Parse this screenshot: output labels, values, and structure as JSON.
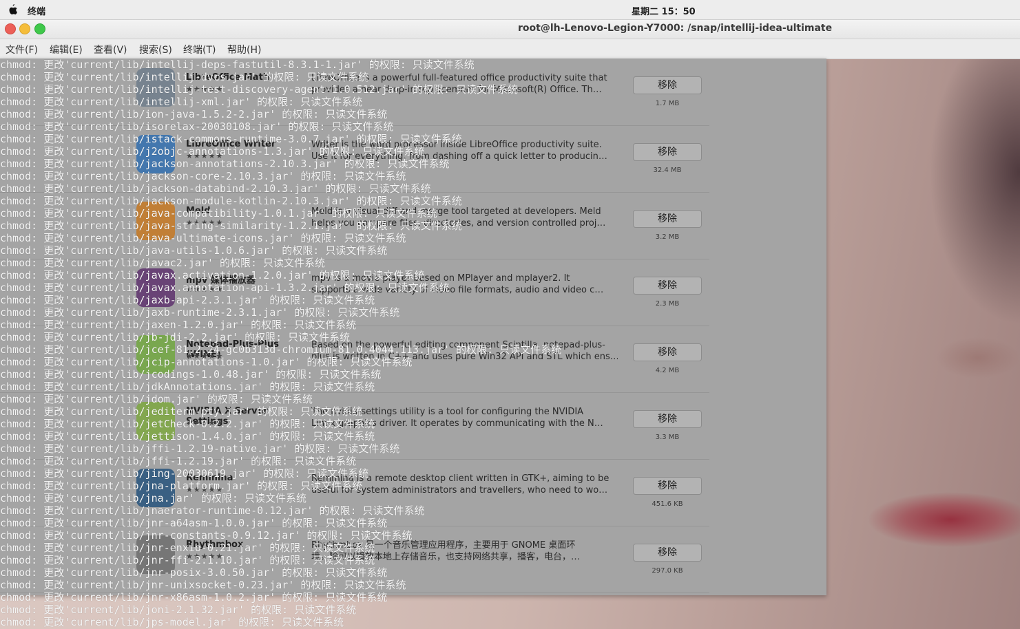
{
  "topbar": {
    "app_name": "终端",
    "clock": "星期二 15：50"
  },
  "window": {
    "title": "root@lh-Lenovo-Legion-Y7000: /snap/intellij-idea-ultimate"
  },
  "menu": [
    "文件(F)",
    "编辑(E)",
    "查看(V)",
    "搜索(S)",
    "终端(T)",
    "帮助(H)"
  ],
  "software": [
    {
      "name": "LibreOffice Math",
      "stars": "★★★★★",
      "desc1": "LibreOffice is a powerful full-featured office productivity suite that",
      "desc2": "provides a near drop-in replacement for Microsoft(R) Office.  Th…",
      "button": "移除",
      "size": "1.7 MB",
      "icon_color": "#6b7b8a"
    },
    {
      "name": "LibreOffice Writer",
      "stars": "★★★★★",
      "desc1": "Writer is the word processor inside LibreOffice productivity suite.",
      "desc2": "Use it for everything, from dashing off a quick letter to producin…",
      "button": "移除",
      "size": "32.4 MB",
      "icon_color": "#2a6cb0"
    },
    {
      "name": "Meld",
      "stars": "★★★★★",
      "desc1": "Meld is a visual diff and merge tool targeted at developers. Meld",
      "desc2": "helps you compare files, directories, and version controlled proj…",
      "button": "移除",
      "size": "3.2 MB",
      "icon_color": "#c8761a"
    },
    {
      "name": "mpv 媒体播放器",
      "stars": "★★★★★",
      "desc1": "mpv is a movie player based on MPlayer and mplayer2. It",
      "desc2": "supports a wide variety of video file formats, audio and video c…",
      "button": "移除",
      "size": "2.3 MB",
      "icon_color": "#5a2a6a"
    },
    {
      "name": "Notepad-Plus-Plus (WINE)",
      "stars": "★★★★★",
      "desc1": "Based on the powerful editing component Scintilla, notepad-plus-",
      "desc2": "plus is written in C++ and uses pure Win32 API and STL which ens…",
      "button": "移除",
      "size": "4.2 MB",
      "icon_color": "#6ea83a"
    },
    {
      "name": "NVIDIA X Server Settings",
      "stars": "★★★★★",
      "desc1": "The nvidia-settings utility is a tool for configuring the NVIDIA",
      "desc2": "Linux graphics driver.  It operates by communicating with the N…",
      "button": "移除",
      "size": "3.3 MB",
      "icon_color": "#7aa83a"
    },
    {
      "name": "Remmina",
      "stars": "★★★★★",
      "desc1": "Remmina is a remote desktop client written in GTK+, aiming to be",
      "desc2": "useful for system administrators and travellers, who need to wo…",
      "button": "移除",
      "size": "451.6 KB",
      "icon_color": "#1f4f7a"
    },
    {
      "name": "Rhythmbox",
      "stars": "★★★★★",
      "desc1": "Rhythmbox 是一个音乐管理应用程序，主要用于 GNOME 桌面环",
      "desc2": "境。除可以播放本地上存储音乐，也支持网络共享，播客，电台，…",
      "button": "移除",
      "size": "297.0 KB",
      "icon_color": "#6a6a6a"
    }
  ],
  "terminal_lines": [
    "chmod: 更改'current/lib/intellij-deps-fastutil-8.3.1-1.jar' 的权限: 只读文件系统",
    "chmod: 更改'current/lib/intellij-dvcs.jar' 的权限: 只读文件系统",
    "chmod: 更改'current/lib/intellij-test-discovery-agent-1.0.512.jar' 的权限: 只读文件系统",
    "chmod: 更改'current/lib/intellij-xml.jar' 的权限: 只读文件系统",
    "chmod: 更改'current/lib/ion-java-1.5.2-2.jar' 的权限: 只读文件系统",
    "chmod: 更改'current/lib/isorelax-20030108.jar' 的权限: 只读文件系统",
    "chmod: 更改'current/lib/istack-commons-runtime-3.0.7.jar' 的权限: 只读文件系统",
    "chmod: 更改'current/lib/j2objc-annotations-1.3.jar' 的权限: 只读文件系统",
    "chmod: 更改'current/lib/jackson-annotations-2.10.3.jar' 的权限: 只读文件系统",
    "chmod: 更改'current/lib/jackson-core-2.10.3.jar' 的权限: 只读文件系统",
    "chmod: 更改'current/lib/jackson-databind-2.10.3.jar' 的权限: 只读文件系统",
    "chmod: 更改'current/lib/jackson-module-kotlin-2.10.3.jar' 的权限: 只读文件系统",
    "chmod: 更改'current/lib/java-compatibility-1.0.1.jar' 的权限: 只读文件系统",
    "chmod: 更改'current/lib/java-string-similarity-1.2.1.jar' 的权限: 只读文件系统",
    "chmod: 更改'current/lib/java-ultimate-icons.jar' 的权限: 只读文件系统",
    "chmod: 更改'current/lib/java-utils-1.0.6.jar' 的权限: 只读文件系统",
    "chmod: 更改'current/lib/javac2.jar' 的权限: 只读文件系统",
    "chmod: 更改'current/lib/javax.activation-1.2.0.jar' 的权限: 只读文件系统",
    "chmod: 更改'current/lib/javax.annotation-api-1.3.2.jar' 的权限: 只读文件系统",
    "chmod: 更改'current/lib/jaxb-api-2.3.1.jar' 的权限: 只读文件系统",
    "chmod: 更改'current/lib/jaxb-runtime-2.3.1.jar' 的权限: 只读文件系统",
    "chmod: 更改'current/lib/jaxen-1.2.0.jar' 的权限: 只读文件系统",
    "chmod: 更改'current/lib/jb-jdi-2.2.jar' 的权限: 只读文件系统",
    "chmod: 更改'current/lib/jcef-81.2.24-gc0b313d-chromium-81.0.4044.113.jar' 的权限: 只读文件系统",
    "chmod: 更改'current/lib/jcip-annotations-1.0.jar' 的权限: 只读文件系统",
    "chmod: 更改'current/lib/jcodings-1.0.48.jar' 的权限: 只读文件系统",
    "chmod: 更改'current/lib/jdkAnnotations.jar' 的权限: 只读文件系统",
    "chmod: 更改'current/lib/jdom.jar' 的权限: 只读文件系统",
    "chmod: 更改'current/lib/jediterm-pty.jar' 的权限: 只读文件系统",
    "chmod: 更改'current/lib/jetCheck-0.2.2.jar' 的权限: 只读文件系统",
    "chmod: 更改'current/lib/jettison-1.4.0.jar' 的权限: 只读文件系统",
    "chmod: 更改'current/lib/jffi-1.2.19-native.jar' 的权限: 只读文件系统",
    "chmod: 更改'current/lib/jffi-1.2.19.jar' 的权限: 只读文件系统",
    "chmod: 更改'current/lib/jing-20030619.jar' 的权限: 只读文件系统",
    "chmod: 更改'current/lib/jna-platform.jar' 的权限: 只读文件系统",
    "chmod: 更改'current/lib/jna.jar' 的权限: 只读文件系统",
    "chmod: 更改'current/lib/jnaerator-runtime-0.12.jar' 的权限: 只读文件系统",
    "chmod: 更改'current/lib/jnr-a64asm-1.0.0.jar' 的权限: 只读文件系统",
    "chmod: 更改'current/lib/jnr-constants-0.9.12.jar' 的权限: 只读文件系统",
    "chmod: 更改'current/lib/jnr-enxio-0.21.jar' 的权限: 只读文件系统",
    "chmod: 更改'current/lib/jnr-ffi-2.1.10.jar' 的权限: 只读文件系统",
    "chmod: 更改'current/lib/jnr-posix-3.0.50.jar' 的权限: 只读文件系统",
    "chmod: 更改'current/lib/jnr-unixsocket-0.23.jar' 的权限: 只读文件系统",
    "chmod: 更改'current/lib/jnr-x86asm-1.0.2.jar' 的权限: 只读文件系统",
    "chmod: 更改'current/lib/joni-2.1.32.jar' 的权限: 只读文件系统",
    "chmod: 更改'current/lib/jps-model.jar' 的权限: 只读文件系统"
  ]
}
